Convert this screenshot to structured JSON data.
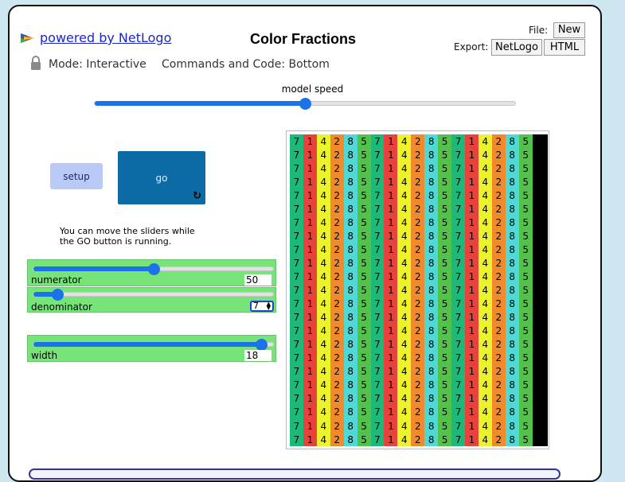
{
  "header": {
    "link_text": "powered by NetLogo",
    "title": "Color Fractions",
    "file_label": "File:",
    "new_button": "New",
    "export_label": "Export:",
    "export_netlogo": "NetLogo",
    "export_html": "HTML"
  },
  "status": {
    "mode_text": "Mode: Interactive",
    "commands_text": "Commands and Code: Bottom"
  },
  "speed": {
    "label": "model speed",
    "value": 0.5
  },
  "buttons": {
    "setup": "setup",
    "go": "go",
    "go_forever_icon": "↻"
  },
  "note": "You can move the sliders while the GO button is running.",
  "sliders": {
    "numerator": {
      "label": "numerator",
      "value": "50",
      "fraction": 0.5
    },
    "denominator": {
      "label": "denominator",
      "value": "7",
      "fraction": 0.1
    },
    "width": {
      "label": "width",
      "value": "18",
      "fraction": 0.95
    }
  },
  "view": {
    "rows": 23,
    "columns": [
      {
        "label": "7",
        "color": "#1db97a"
      },
      {
        "label": "1",
        "color": "#e8423c"
      },
      {
        "label": "4",
        "color": "#ecf22b"
      },
      {
        "label": "2",
        "color": "#f08a2b"
      },
      {
        "label": "8",
        "color": "#4fd9d6"
      },
      {
        "label": "5",
        "color": "#52c24a"
      },
      {
        "label": "7",
        "color": "#1db97a"
      },
      {
        "label": "1",
        "color": "#e8423c"
      },
      {
        "label": "4",
        "color": "#ecf22b"
      },
      {
        "label": "2",
        "color": "#f08a2b"
      },
      {
        "label": "8",
        "color": "#4fd9d6"
      },
      {
        "label": "5",
        "color": "#52c24a"
      },
      {
        "label": "7",
        "color": "#1db97a"
      },
      {
        "label": "1",
        "color": "#e8423c"
      },
      {
        "label": "4",
        "color": "#ecf22b"
      },
      {
        "label": "2",
        "color": "#f08a2b"
      },
      {
        "label": "8",
        "color": "#4fd9d6"
      },
      {
        "label": "5",
        "color": "#52c24a"
      },
      {
        "label": "",
        "color": "#000000"
      }
    ]
  }
}
